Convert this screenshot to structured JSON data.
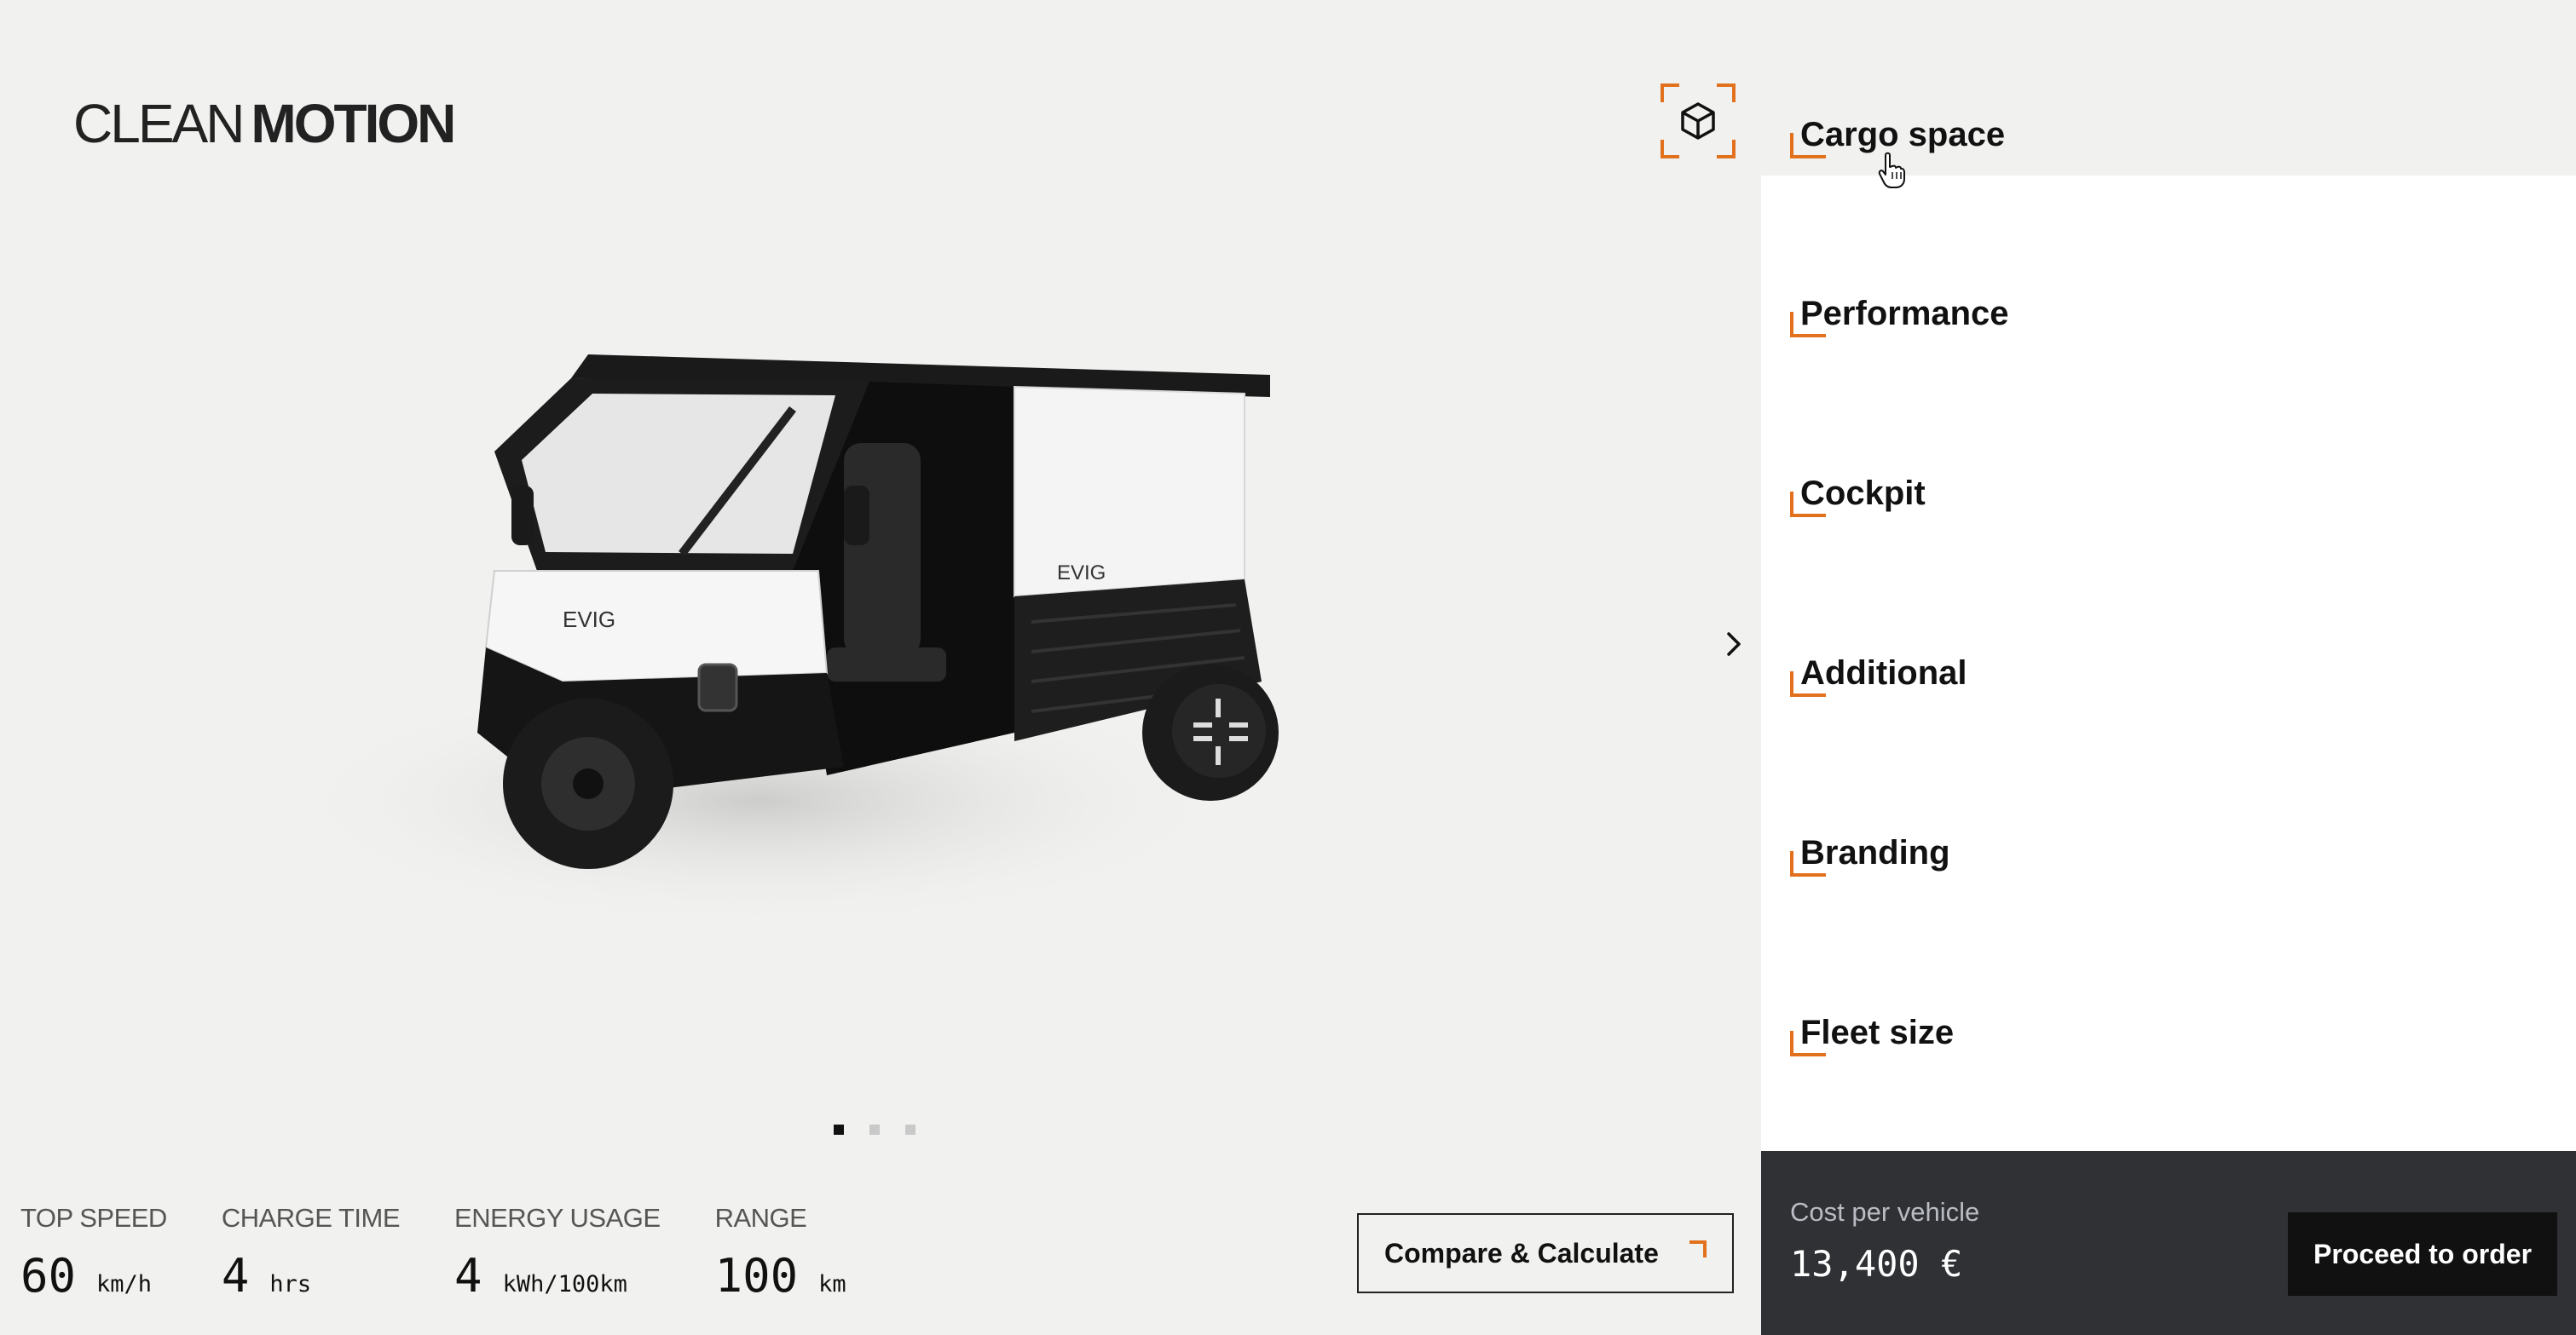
{
  "brand": {
    "light": "CLEAN",
    "bold": "MOTION"
  },
  "accent_color": "#e2711d",
  "icons": {
    "ar_view": "3d-cube-icon",
    "next": "chevron-right-icon",
    "cursor": "hand-pointer-icon"
  },
  "carousel": {
    "total": 3,
    "active_index": 1
  },
  "specs": [
    {
      "label": "TOP SPEED",
      "value": "60",
      "unit": "km/h"
    },
    {
      "label": "CHARGE TIME",
      "value": "4",
      "unit": "hrs"
    },
    {
      "label": "ENERGY USAGE",
      "value": "4",
      "unit": "kWh/100km"
    },
    {
      "label": "RANGE",
      "value": "100",
      "unit": "km"
    }
  ],
  "compare_button": {
    "label": "Compare & Calculate"
  },
  "vehicle": {
    "side_text": "EVIG"
  },
  "config_sections": [
    {
      "label": "Cargo space",
      "hovered": true
    },
    {
      "label": "Performance",
      "hovered": false
    },
    {
      "label": "Cockpit",
      "hovered": false
    },
    {
      "label": "Additional",
      "hovered": false
    },
    {
      "label": "Branding",
      "hovered": false
    },
    {
      "label": "Fleet size",
      "hovered": false
    }
  ],
  "footer": {
    "cost_label": "Cost per vehicle",
    "cost_value": "13,400 €",
    "order_label": "Proceed to order"
  }
}
